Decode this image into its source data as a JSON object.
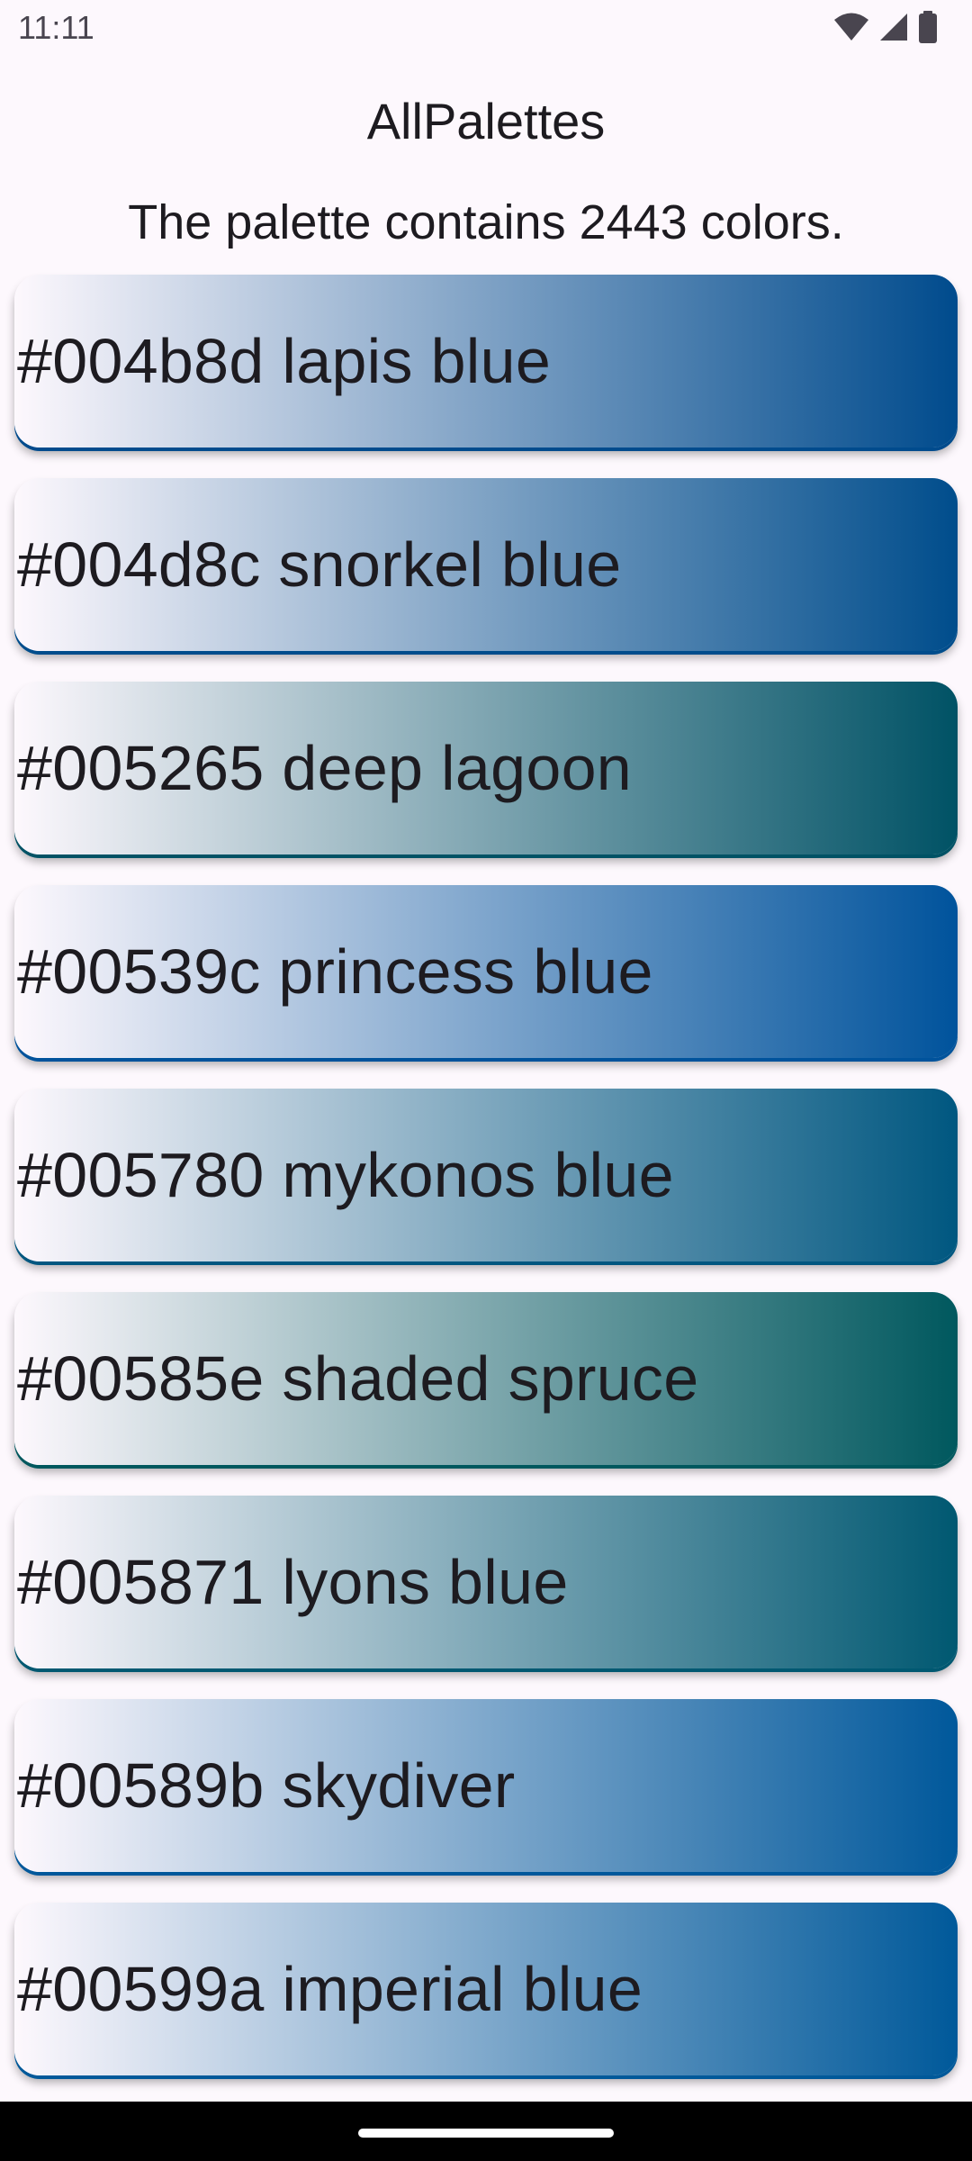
{
  "status_bar": {
    "time": "11:11",
    "icons": [
      "wifi-icon",
      "signal-icon",
      "battery-icon"
    ]
  },
  "app": {
    "title": "AllPalettes",
    "subtitle": "The palette contains 2443 colors."
  },
  "colors": [
    {
      "hex": "#004b8d",
      "label": "#004b8d lapis blue"
    },
    {
      "hex": "#004d8c",
      "label": "#004d8c snorkel blue"
    },
    {
      "hex": "#005265",
      "label": "#005265 deep lagoon"
    },
    {
      "hex": "#00539c",
      "label": "#00539c princess blue"
    },
    {
      "hex": "#005780",
      "label": "#005780 mykonos blue"
    },
    {
      "hex": "#00585e",
      "label": "#00585e shaded spruce"
    },
    {
      "hex": "#005871",
      "label": "#005871 lyons blue"
    },
    {
      "hex": "#00589b",
      "label": "#00589b skydiver"
    },
    {
      "hex": "#00599a",
      "label": "#00599a imperial blue"
    }
  ]
}
